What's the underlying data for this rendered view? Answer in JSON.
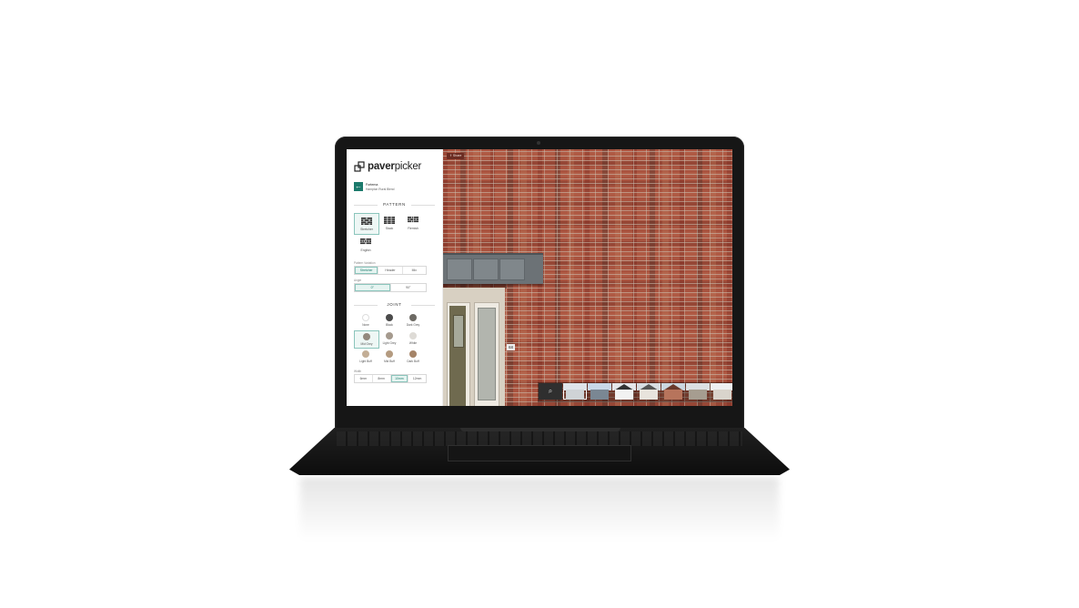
{
  "brand": {
    "logo_text_bold": "paver",
    "logo_text_light": "picker",
    "accent": "#1c7a6c"
  },
  "product": {
    "name": "Fortema",
    "subtitle": "Hampton Rural Blend"
  },
  "pattern": {
    "title": "PATTERN",
    "tiles": [
      {
        "label": "Stretcher",
        "icon": "stretcher-bond-icon",
        "selected": true
      },
      {
        "label": "Stack",
        "icon": "stack-bond-icon",
        "selected": false
      },
      {
        "label": "Flemish",
        "icon": "flemish-bond-icon",
        "selected": false
      },
      {
        "label": "English",
        "icon": "english-bond-icon",
        "selected": false
      }
    ],
    "variation_label": "Pattern Variation",
    "variations": [
      "Stretcher",
      "Header",
      "Mix"
    ],
    "angle_label": "Angle",
    "angles": [
      "0°",
      "90°"
    ]
  },
  "joint": {
    "title": "JOINT",
    "colours": [
      {
        "label": "None",
        "color": "#ffffff",
        "selected": false
      },
      {
        "label": "Black",
        "color": "#4b4b4b",
        "selected": false
      },
      {
        "label": "Dark Grey",
        "color": "#6d6a64",
        "selected": false
      },
      {
        "label": "Mid Grey",
        "color": "#93887d",
        "selected": true
      },
      {
        "label": "Light Grey",
        "color": "#a59a8e",
        "selected": false
      },
      {
        "label": "White",
        "color": "#dedbd6",
        "selected": false
      },
      {
        "label": "Light Buff",
        "color": "#c3ae96",
        "selected": false
      },
      {
        "label": "Mid Buff",
        "color": "#b49b80",
        "selected": false
      },
      {
        "label": "Dark Buff",
        "color": "#a58468",
        "selected": false
      }
    ],
    "width_label": "Width",
    "widths": [
      "6mm",
      "8mm",
      "10mm",
      "12mm"
    ]
  },
  "preview": {
    "share_label": "Share",
    "house_number": "68",
    "search_icon": "search-icon",
    "thumbnails": [
      "scene-1",
      "scene-2",
      "scene-3",
      "scene-4",
      "scene-5",
      "scene-6",
      "scene-7"
    ]
  }
}
